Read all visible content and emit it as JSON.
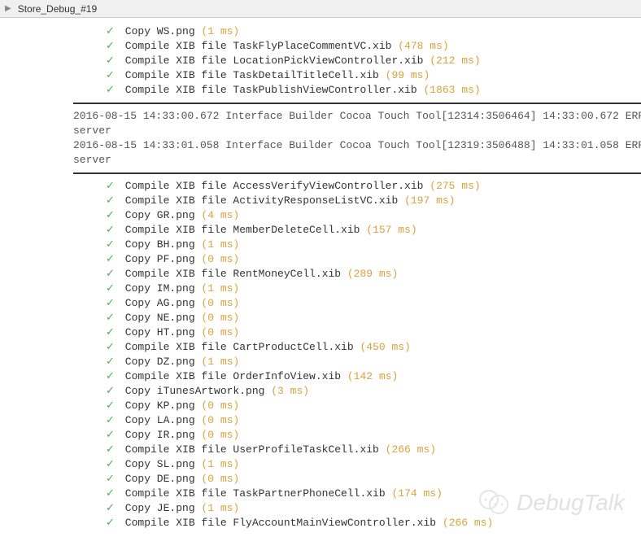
{
  "tab": {
    "title": "Store_Debug_#19"
  },
  "block1": [
    {
      "text": "Copy WS.png",
      "duration": "(1 ms)"
    },
    {
      "text": "Compile XIB file TaskFlyPlaceCommentVC.xib",
      "duration": "(478 ms)"
    },
    {
      "text": "Compile XIB file LocationPickViewController.xib",
      "duration": "(212 ms)"
    },
    {
      "text": "Compile XIB file TaskDetailTitleCell.xib",
      "duration": "(99 ms)"
    },
    {
      "text": "Compile XIB file TaskPublishViewController.xib",
      "duration": "(1863 ms)"
    }
  ],
  "log_lines": [
    "2016-08-15 14:33:00.672 Interface Builder Cocoa Touch Tool[12314:3506464] 14:33:00.672 ERR",
    "server",
    "2016-08-15 14:33:01.058 Interface Builder Cocoa Touch Tool[12319:3506488] 14:33:01.058 ERR",
    "server"
  ],
  "block2": [
    {
      "text": "Compile XIB file AccessVerifyViewController.xib",
      "duration": "(275 ms)"
    },
    {
      "text": "Compile XIB file ActivityResponseListVC.xib",
      "duration": "(197 ms)"
    },
    {
      "text": "Copy GR.png",
      "duration": "(4 ms)"
    },
    {
      "text": "Compile XIB file MemberDeleteCell.xib",
      "duration": "(157 ms)"
    },
    {
      "text": "Copy BH.png",
      "duration": "(1 ms)"
    },
    {
      "text": "Copy PF.png",
      "duration": "(0 ms)"
    },
    {
      "text": "Compile XIB file RentMoneyCell.xib",
      "duration": "(289 ms)"
    },
    {
      "text": "Copy IM.png",
      "duration": "(1 ms)"
    },
    {
      "text": "Copy AG.png",
      "duration": "(0 ms)"
    },
    {
      "text": "Copy NE.png",
      "duration": "(0 ms)"
    },
    {
      "text": "Copy HT.png",
      "duration": "(0 ms)"
    },
    {
      "text": "Compile XIB file CartProductCell.xib",
      "duration": "(450 ms)"
    },
    {
      "text": "Copy DZ.png",
      "duration": "(1 ms)"
    },
    {
      "text": "Compile XIB file OrderInfoView.xib",
      "duration": "(142 ms)"
    },
    {
      "text": "Copy iTunesArtwork.png",
      "duration": "(3 ms)"
    },
    {
      "text": "Copy KP.png",
      "duration": "(0 ms)"
    },
    {
      "text": "Copy LA.png",
      "duration": "(0 ms)"
    },
    {
      "text": "Copy IR.png",
      "duration": "(0 ms)"
    },
    {
      "text": "Compile XIB file UserProfileTaskCell.xib",
      "duration": "(266 ms)"
    },
    {
      "text": "Copy SL.png",
      "duration": "(1 ms)"
    },
    {
      "text": "Copy DE.png",
      "duration": "(0 ms)"
    },
    {
      "text": "Compile XIB file TaskPartnerPhoneCell.xib",
      "duration": "(174 ms)"
    },
    {
      "text": "Copy JE.png",
      "duration": "(1 ms)"
    },
    {
      "text": "Compile XIB file FlyAccountMainViewController.xib",
      "duration": "(266 ms)"
    }
  ],
  "watermark": {
    "text": "DebugTalk"
  }
}
